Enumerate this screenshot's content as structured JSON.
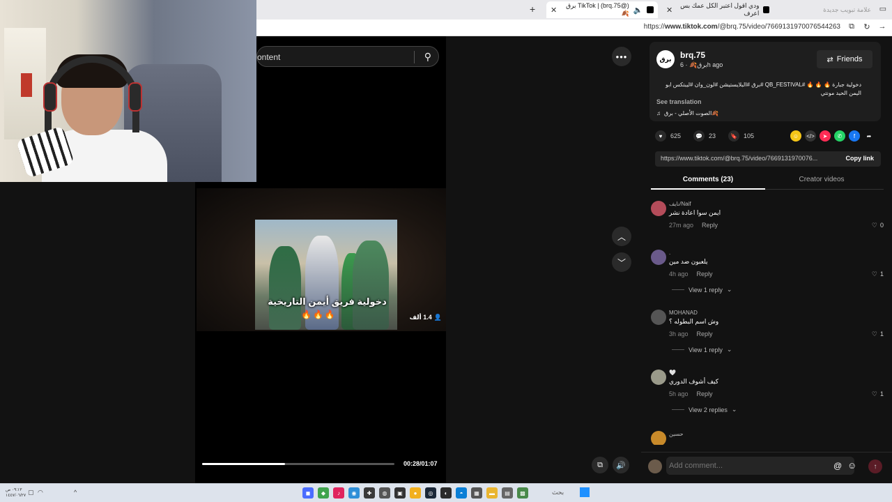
{
  "browser": {
    "tabs": [
      {
        "label": "علامة تبويب جديدة",
        "state": "faded"
      },
      {
        "label": "ودي اقول اعتبر الكل عمك بس اعرف",
        "state": "normal"
      },
      {
        "label": "TikTok | (brq.75@) برق🍂",
        "state": "active"
      }
    ],
    "url_prefix": "https://",
    "url_domain": "www.tiktok.com",
    "url_path": "/@brq.75/video/7669131970076544263"
  },
  "search": {
    "value": "ontent"
  },
  "video": {
    "caption": "دخولية فريق أيمن التاريخية",
    "fires": "🔥🔥🔥",
    "viewers": "1.4 ألف",
    "time": "00:28/01:07",
    "progress": 0.43
  },
  "post": {
    "avatar_text": "برق",
    "author": "brq.75",
    "author_display": "برق🍂",
    "time_ago": "6h ago",
    "friends_label": "Friends",
    "description": "دخولية جبارة 🔥 🔥 🔥 #QB_FESTIVAL #برق #البلايستيشن #لون_وان #ليبتكس ابو اليمن الحيد مونتي",
    "see_translation": "See translation",
    "music": "الصوت الأصلي - برق🍂",
    "likes": "625",
    "comments_count": "23",
    "saves": "105",
    "link": "https://www.tiktok.com/@brq.75/video/7669131970076...",
    "copy_label": "Copy link"
  },
  "comment_tabs": {
    "comments": "Comments (23)",
    "creator": "Creator videos"
  },
  "comments": [
    {
      "name": "نايف/Naif",
      "text": "ايمن سوا اعادة نشر",
      "time": "27m ago",
      "reply": "Reply",
      "likes": "0",
      "view": ""
    },
    {
      "name": ".",
      "text": "يلعبون ضد مين",
      "time": "4h ago",
      "reply": "Reply",
      "likes": "1",
      "view": "View 1 reply"
    },
    {
      "name": "MOHANAD",
      "text": "وش اسم البطوله ؟",
      "time": "3h ago",
      "reply": "Reply",
      "likes": "1",
      "view": "View 1 reply"
    },
    {
      "name": "🤍",
      "text": "كيف أشوف الدوري",
      "time": "5h ago",
      "reply": "Reply",
      "likes": "1",
      "view": "View 2 replies"
    },
    {
      "name": "حسين",
      "text": "",
      "time": "",
      "reply": "",
      "likes": "",
      "view": ""
    }
  ],
  "comment_input": {
    "placeholder": "Add comment..."
  },
  "taskbar": {
    "clock_time": "٠٩:١٣ ص",
    "clock_date": "١٤٤٧/٠٦/٢٧",
    "search": "بحث"
  },
  "colors": {
    "accent": "#fe2c55",
    "facebook": "#1877f2",
    "whatsapp": "#25d366",
    "sidebar_bg": "#121212"
  }
}
